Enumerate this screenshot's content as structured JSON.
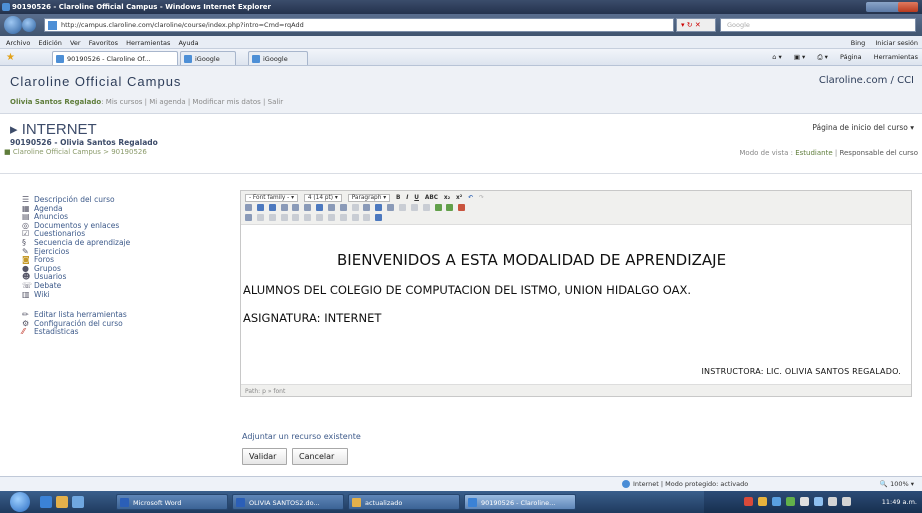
{
  "browser": {
    "window_title": "90190526 - Claroline Official Campus - Windows Internet Explorer",
    "url": "http://campus.claroline.com/claroline/course/index.php?intro=Cmd=rqAdd",
    "search_placeholder": "Google",
    "menu": [
      "Archivo",
      "Edición",
      "Ver",
      "Favoritos",
      "Herramientas",
      "Ayuda"
    ],
    "menu_right": [
      "Bing",
      "Iniciar sesión"
    ],
    "tabs": [
      "90190526 - Claroline Of...",
      "iGoogle"
    ],
    "favorite_link": "iGoogle",
    "tools_right": [
      "Página",
      "Herramientas"
    ],
    "status_zone": "Internet | Modo protegido: activado",
    "zoom": "100%"
  },
  "site": {
    "title": "Claroline Official Campus",
    "link": "Claroline.com / CCI",
    "user_name": "Olivia Santos Regalado",
    "user_links": ": Mis cursos | Mi agenda | Modificar mis datos | Salir"
  },
  "course": {
    "name": "INTERNET",
    "code_title": "90190526 - Olivia Santos Regalado",
    "breadcrumb": "Claroline Official Campus > 90190526",
    "home_select": "Página de inicio del curso",
    "view_mode_label": "Modo de vista :",
    "view_mode_student": "Estudiante",
    "view_mode_manager": "Responsable del curso"
  },
  "tools": [
    {
      "label": "Descripción del curso",
      "icon": "list-icon"
    },
    {
      "label": "Agenda",
      "icon": "calendar-icon"
    },
    {
      "label": "Anuncios",
      "icon": "announcement-icon"
    },
    {
      "label": "Documentos y enlaces",
      "icon": "documents-icon"
    },
    {
      "label": "Cuestionarios",
      "icon": "checkbox-icon"
    },
    {
      "label": "Secuencia de aprendizaje",
      "icon": "path-icon"
    },
    {
      "label": "Ejercicios",
      "icon": "exercise-icon"
    },
    {
      "label": "Foros",
      "icon": "forum-icon"
    },
    {
      "label": "Grupos",
      "icon": "group-icon"
    },
    {
      "label": "Usuarios",
      "icon": "user-icon"
    },
    {
      "label": "Debate",
      "icon": "chat-icon"
    },
    {
      "label": "Wiki",
      "icon": "wiki-icon"
    }
  ],
  "admin_tools": [
    {
      "label": "Editar lista herramientas",
      "icon": "pencil-icon"
    },
    {
      "label": "Configuración del curso",
      "icon": "settings-icon"
    },
    {
      "label": "Estadísticas",
      "icon": "stats-icon"
    }
  ],
  "editor": {
    "font_family": "- Font family -",
    "font_size": "4 (14 pt)",
    "format": "Paragraph",
    "title_line": "BIENVENIDOS A ESTA MODALIDAD DE APRENDIZAJE",
    "line1": "ALUMNOS DEL COLEGIO DE COMPUTACION DEL ISTMO, UNION HIDALGO OAX.",
    "line2": "ASIGNATURA: INTERNET",
    "line3": "INSTRUCTORA: LIC. OLIVIA SANTOS REGALADO.",
    "path": "Path: p » font"
  },
  "actions": {
    "attach": "Adjuntar un recurso existente",
    "validate": "Validar",
    "cancel": "Cancelar"
  },
  "taskbar": {
    "tasks": [
      "Microsoft Word",
      "OLIVIA SANTOS2.do...",
      "actualizado",
      "90190526 - Claroline..."
    ],
    "clock": "11:49 a.m."
  }
}
